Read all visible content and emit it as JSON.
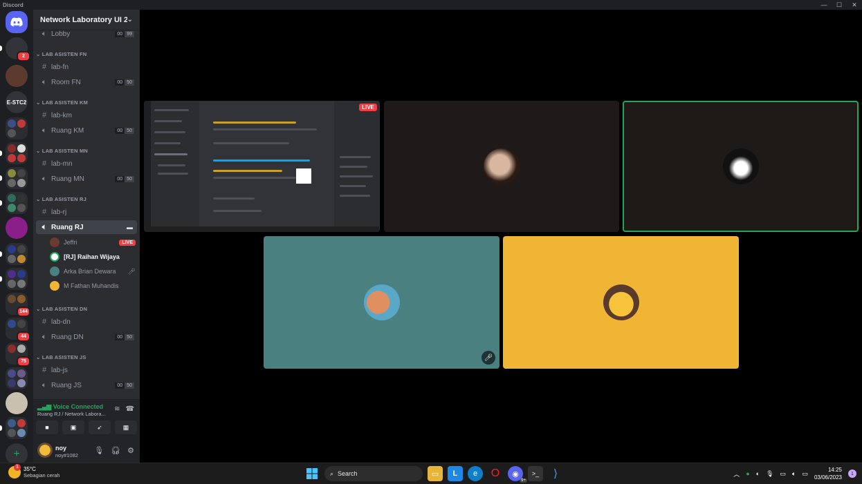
{
  "window": {
    "title": "Discord",
    "controls": [
      "—",
      "☐",
      "✕"
    ]
  },
  "guilds": {
    "home_icon": "discord-logo",
    "add_label": "+",
    "items": [
      {
        "label": "",
        "badge": "2",
        "color": "#2b2d31"
      },
      {
        "label": "",
        "badge": "",
        "color": "#5c3b2e"
      },
      {
        "label": "E-STC2",
        "badge": "",
        "color": "#2b2d31"
      },
      {
        "label": "",
        "badge": "",
        "color": "#3c4d8a"
      },
      {
        "label": "",
        "badge": "",
        "color": "#8a2b2b"
      },
      {
        "label": "",
        "badge": "",
        "color": "#6b6b2e"
      },
      {
        "label": "",
        "badge": "",
        "color": "#2e6b5c"
      },
      {
        "label": "",
        "badge": "",
        "color": "#8a1f8a"
      },
      {
        "label": "",
        "badge": "",
        "color": "#2b3b8a"
      },
      {
        "label": "",
        "badge": "",
        "color": "#4e2e8a"
      },
      {
        "label": "",
        "badge": "144",
        "color": "#6b4b2e"
      },
      {
        "label": "",
        "badge": "44",
        "color": "#2e4b8a"
      },
      {
        "label": "",
        "badge": "75",
        "color": "#8a2e2e"
      },
      {
        "label": "",
        "badge": "",
        "color": "#4b4b8a"
      },
      {
        "label": "",
        "badge": "",
        "color": "#c9c0b0"
      },
      {
        "label": "",
        "badge": "",
        "color": "#3b5b8a"
      }
    ]
  },
  "server": {
    "name": "Network Laboratory UI 2...",
    "lobby": {
      "label": "Lobby",
      "count_left": "00",
      "count_right": "99"
    },
    "categories": [
      {
        "label": "LAB ASISTEN FN",
        "text_channel": "lab-fn",
        "voice_channel": "Room FN",
        "count_left": "00",
        "count_right": "50"
      },
      {
        "label": "LAB ASISTEN KM",
        "text_channel": "lab-km",
        "voice_channel": "Ruang KM",
        "count_left": "00",
        "count_right": "50"
      },
      {
        "label": "LAB ASISTEN MN",
        "text_channel": "lab-mn",
        "voice_channel": "Ruang MN",
        "count_left": "00",
        "count_right": "50"
      },
      {
        "label": "LAB ASISTEN RJ",
        "text_channel": "lab-rj",
        "voice_channel": "Ruang RJ"
      },
      {
        "label": "LAB ASISTEN DN",
        "text_channel": "lab-dn",
        "voice_channel": "Ruang DN",
        "count_left": "00",
        "count_right": "50"
      },
      {
        "label": "LAB ASISTEN JS",
        "text_channel": "lab-js",
        "voice_channel": "Ruang JS",
        "count_left": "00",
        "count_right": "50"
      }
    ],
    "voice_users": [
      {
        "name": "Jeffri",
        "status": "LIVE"
      },
      {
        "name": "[RJ] Raihan Wijaya",
        "status": ""
      },
      {
        "name": "Arka Brian Dewara",
        "status": "deafened"
      },
      {
        "name": "M Fathan Muhandis",
        "status": ""
      }
    ]
  },
  "voice_panel": {
    "status": "Voice Connected",
    "location": "Ruang RJ / Network Labora..."
  },
  "user": {
    "name": "noy",
    "tag": "noy#1082"
  },
  "stage": {
    "stream_live_label": "LIVE",
    "tile_colors": {
      "dark1": "#1f1a19",
      "dark2": "#1d1a18",
      "teal": "#4a8180",
      "yellow": "#f0b535",
      "speaking_border": "#23a55a"
    }
  },
  "taskbar": {
    "weather_temp": "35°C",
    "weather_condition": "Sebagian cerah",
    "weather_badge": "1",
    "search_placeholder": "Search",
    "discord_badge": "9+",
    "time": "14:25",
    "date": "03/06/2023",
    "notification_count": "1"
  }
}
